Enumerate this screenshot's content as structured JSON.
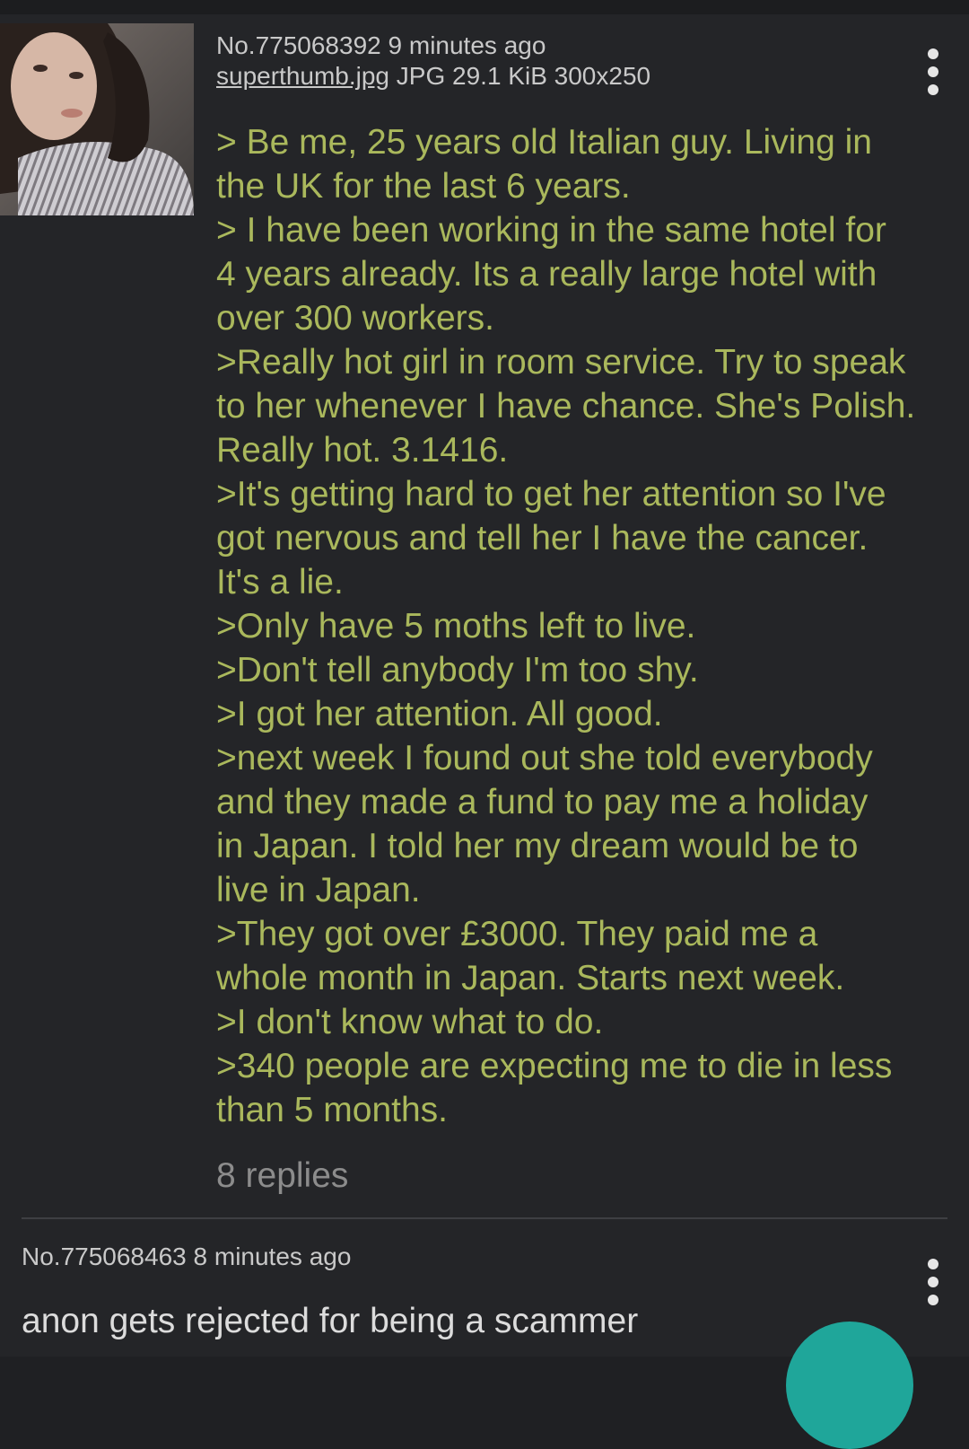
{
  "post": {
    "number": "No.775068392",
    "time": "9 minutes ago",
    "file_name": "superthumb.jpg",
    "file_info": "JPG 29.1 KiB 300x250",
    "thumbnail_icon": "photo-thumbnail",
    "lines": [
      "> Be me, 25 years old Italian guy. Living in",
      "the UK for the last 6 years.",
      "> I have been working in the same hotel for",
      "4 years already. Its a really large hotel with",
      "over 300 workers.",
      ">Really hot girl in room service. Try to speak",
      "to her whenever I have chance. She's Polish.",
      "Really hot. 3.1416.",
      ">It's getting hard to get her attention so I've",
      "got nervous and tell her I have the cancer.",
      "It's a lie.",
      ">Only have 5 moths left to live.",
      ">Don't tell anybody I'm too shy.",
      ">I got her attention. All good.",
      ">next week I found out she told everybody",
      "and they made a fund to pay me a holiday",
      "in Japan. I told her my dream would be to",
      "live in Japan.",
      ">They got over £3000. They paid me a",
      "whole month in Japan. Starts next week.",
      ">I don't know what to do.",
      ">340 people are expecting me to die in less",
      "than 5 months."
    ],
    "replies": "8 replies"
  },
  "reply": {
    "number": "No.775068463",
    "time": "8 minutes ago",
    "comment": "anon gets rejected for being a scammer"
  },
  "colors": {
    "background": "#242528",
    "greentext": "#aab85c",
    "meta_text": "#c9c9c9",
    "reply_text": "#dcdcdc",
    "replies_count": "#8c8c8c",
    "fab": "#1fa69a"
  },
  "icons": {
    "overflow_menu": "more-vert-icon",
    "floating_action": "fab-reply-icon"
  }
}
